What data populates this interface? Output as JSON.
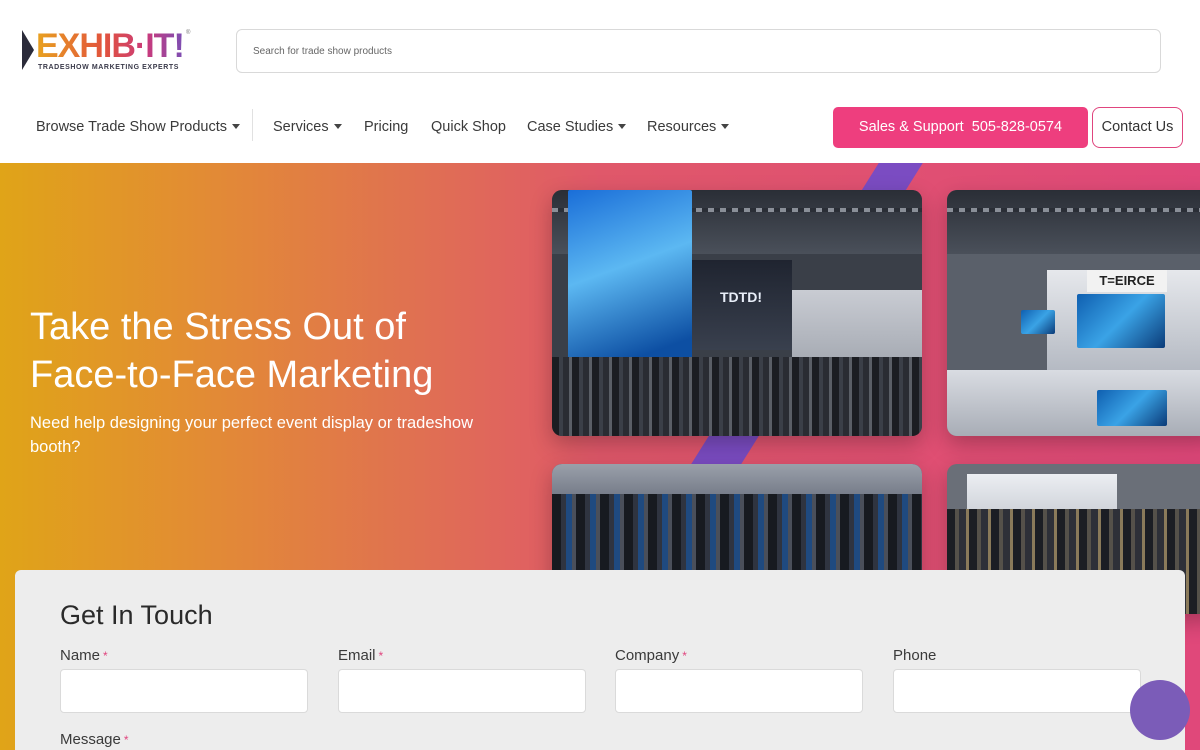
{
  "brand": {
    "logo_text": "EXHIB·IT!",
    "tagline": "TRADESHOW MARKETING EXPERTS",
    "reg_mark": "®",
    "accent_pink": "#ee3e7e",
    "accent_purple": "#7b4cc2"
  },
  "search": {
    "placeholder": "Search for trade show products"
  },
  "nav": {
    "items": [
      {
        "label": "Browse Trade Show Products",
        "dropdown": true
      },
      {
        "label": "Services",
        "dropdown": true
      },
      {
        "label": "Pricing",
        "dropdown": false
      },
      {
        "label": "Quick Shop",
        "dropdown": false
      },
      {
        "label": "Case Studies",
        "dropdown": true
      },
      {
        "label": "Resources",
        "dropdown": true
      }
    ]
  },
  "cta": {
    "sales_label": "Sales & Support",
    "sales_phone": "505-828-0574",
    "contact_label": "Contact Us"
  },
  "hero": {
    "title_line1": "Take the Stress Out of",
    "title_line2": "Face-to-Face Marketing",
    "subtitle": "Need help designing your perfect event display or tradeshow booth?",
    "tile_signs": [
      "TDTD!",
      "T=EIRCE"
    ]
  },
  "form": {
    "title": "Get In Touch",
    "fields": [
      {
        "label": "Name",
        "required": true
      },
      {
        "label": "Email",
        "required": true
      },
      {
        "label": "Company",
        "required": true
      },
      {
        "label": "Phone",
        "required": false
      }
    ],
    "message_label": "Message",
    "required_marker": "*"
  }
}
